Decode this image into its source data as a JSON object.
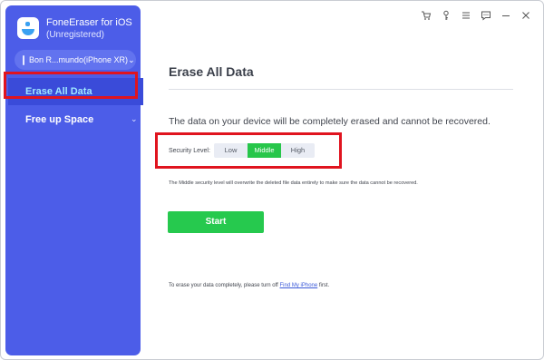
{
  "app": {
    "name": "FoneEraser for iOS",
    "status": "(Unregistered)"
  },
  "device": {
    "name": "Bon R...mundo(iPhone XR)"
  },
  "sidebar": {
    "items": [
      {
        "label": "Erase All Data"
      },
      {
        "label": "Free up Space"
      }
    ]
  },
  "titlebar": {
    "icons": [
      "cart-icon",
      "key-icon",
      "menu-icon",
      "feedback-icon",
      "minimize-icon",
      "close-icon"
    ]
  },
  "main": {
    "title": "Erase All Data",
    "warning": "The data on your device will be completely erased and cannot be recovered.",
    "security_label": "Security Level:",
    "levels": [
      "Low",
      "Middle",
      "High"
    ],
    "selected_level": "Middle",
    "description": "The Middle security level will overwrite the deleted file data entirely to make sure the data cannot be recovered.",
    "start_label": "Start",
    "footer_prefix": "To erase your data completely, please turn off ",
    "footer_link": "Find My iPhone",
    "footer_suffix": " first."
  },
  "colors": {
    "sidebar": "#4c5de8",
    "accent_green": "#26c94e",
    "highlight_red": "#e0141f"
  }
}
